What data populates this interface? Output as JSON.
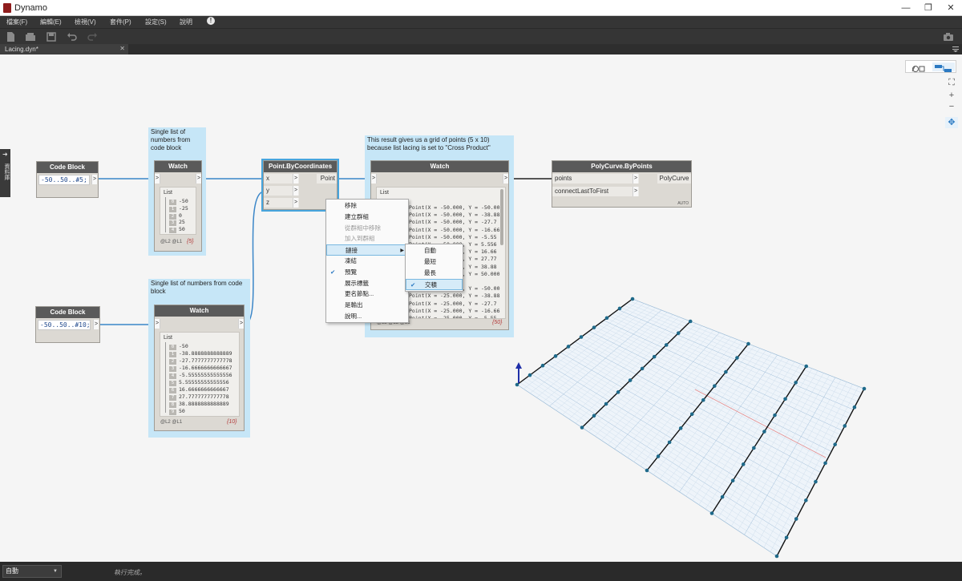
{
  "window": {
    "title": "Dynamo",
    "min": "—",
    "restore": "❐",
    "close": "✕"
  },
  "menu": [
    "檔案(F)",
    "編輯(E)",
    "檢視(V)",
    "套件(P)",
    "設定(S)",
    "說明"
  ],
  "menu_info": "!",
  "tab": {
    "label": "Lacing.dyn*",
    "close": "✕"
  },
  "library_tab": {
    "arrow": "➜",
    "label": "資料庫"
  },
  "zoom": {
    "fit": "⛶",
    "in": "+",
    "out": "−",
    "pan": "✥"
  },
  "groups": {
    "g1": "Single list of numbers from code block",
    "g2": "Single list of numbers from code block",
    "g3": "This result gives us a grid of points (5 x 10) because list lacing is set to \"Cross Product\""
  },
  "nodes": {
    "cb1": {
      "title": "Code Block",
      "code": "-50..50..#5;",
      "out": ">"
    },
    "cb2": {
      "title": "Code Block",
      "code": "-50..50..#10;",
      "out": ">"
    },
    "watch1": {
      "title": "Watch",
      "in": ">",
      "out": ">",
      "list_label": "List",
      "items": [
        {
          "i": "0",
          "v": "-50"
        },
        {
          "i": "1",
          "v": "-25"
        },
        {
          "i": "2",
          "v": "0"
        },
        {
          "i": "3",
          "v": "25"
        },
        {
          "i": "4",
          "v": "50"
        }
      ],
      "footer": "@L2 @L1",
      "count": "{5}"
    },
    "watch2": {
      "title": "Watch",
      "in": ">",
      "out": ">",
      "list_label": "List",
      "items": [
        {
          "i": "0",
          "v": "-50"
        },
        {
          "i": "1",
          "v": "-38.8888888888889"
        },
        {
          "i": "2",
          "v": "-27.7777777777778"
        },
        {
          "i": "3",
          "v": "-16.6666666666667"
        },
        {
          "i": "4",
          "v": "-5.55555555555556"
        },
        {
          "i": "5",
          "v": "5.55555555555556"
        },
        {
          "i": "6",
          "v": "16.6666666666667"
        },
        {
          "i": "7",
          "v": "27.7777777777778"
        },
        {
          "i": "8",
          "v": "38.8888888888889"
        },
        {
          "i": "9",
          "v": "50"
        }
      ],
      "footer": "@L2 @L1",
      "count": "{10}"
    },
    "pbc": {
      "title": "Point.ByCoordinates",
      "x": "x",
      "y": "y",
      "z": "z",
      "out": "Point",
      "arrow": ">"
    },
    "watch3": {
      "title": "Watch",
      "in": ">",
      "out": ">",
      "list_label": "List",
      "lines": [
        "Point(X = -50.000, Y = -50.00",
        "Point(X = -50.000, Y = -38.88",
        "Point(X = -50.000, Y = -27.7",
        "Point(X = -50.000, Y = -16.66",
        "Point(X = -50.000, Y = -5.55",
        "Point(X = -50.000, Y = 5.556",
        "Point(X = -50.000, Y = 16.66",
        "Point(X = -50.000, Y = 27.77",
        "Point(X = -50.000, Y = 38.88",
        "Point(X = -50.000, Y = 50.000",
        "",
        "Point(X = -25.000, Y = -50.00",
        "Point(X = -25.000, Y = -38.88",
        "Point(X = -25.000, Y = -27.7",
        "Point(X = -25.000, Y = -16.66",
        "Point(X = -25.000, Y = -5.55"
      ],
      "footer": "@L3 @L2 @L1",
      "count": "{50}"
    },
    "poly": {
      "title": "PolyCurve.ByPoints",
      "in1": "points",
      "in2": "connectLastToFirst",
      "out": "PolyCurve",
      "arrow": ">",
      "badge": "AUTO"
    }
  },
  "context_menu": [
    {
      "label": "移除",
      "enabled": true
    },
    {
      "label": "建立群組",
      "enabled": true
    },
    {
      "label": "從群組中移除",
      "enabled": false
    },
    {
      "label": "加入到群組",
      "enabled": false
    },
    {
      "label": "鏈接",
      "enabled": true,
      "submenu": true
    },
    {
      "label": "凍結",
      "enabled": true
    },
    {
      "label": "預覽",
      "enabled": true,
      "checked": true
    },
    {
      "label": "展示標籤",
      "enabled": true
    },
    {
      "label": "更名節點...",
      "enabled": true
    },
    {
      "label": "是輸出",
      "enabled": true
    },
    {
      "label": "說明...",
      "enabled": true
    }
  ],
  "lacing_submenu": [
    {
      "label": "自動",
      "checked": false
    },
    {
      "label": "最短",
      "checked": false
    },
    {
      "label": "最長",
      "checked": false
    },
    {
      "label": "交積",
      "checked": true
    }
  ],
  "check_mark": "✔",
  "submenu_arrow": "▶",
  "statusbar": {
    "run_mode": "自動",
    "dropdown": "▼",
    "status": "執行完成。"
  },
  "colors": {
    "group": "#c6e6f7",
    "wire": "#3a86c8",
    "node_header": "#5a5a5a",
    "selection": "#47a5dd"
  }
}
